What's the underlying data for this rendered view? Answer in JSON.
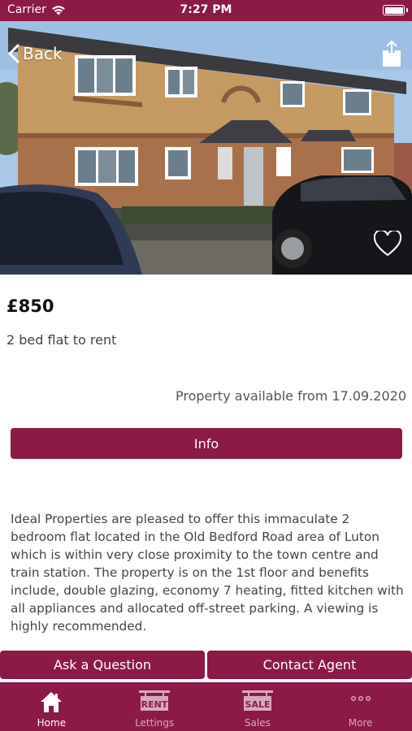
{
  "status_bar": {
    "carrier": "Carrier",
    "time": "7:27 PM"
  },
  "hero": {
    "back_label": "Back"
  },
  "listing": {
    "price": "£850",
    "subtitle": "2 bed flat to rent",
    "availability": "Property available from 17.09.2020",
    "info_label": "Info",
    "description": "Ideal Properties are pleased to offer this immaculate 2 bedroom flat located in the Old Bedford Road area of Luton which is within very close proximity to the town centre and train station. The property is on the 1st floor and benefits include, double glazing, economy 7 heating, fitted kitchen with all appliances and allocated off-street parking. A viewing is highly recommended."
  },
  "actions": {
    "ask": "Ask a Question",
    "contact": "Contact Agent"
  },
  "tabs": [
    {
      "label": "Home",
      "icon": "home-icon",
      "active": true
    },
    {
      "label": "Lettings",
      "icon": "rent-sign-icon",
      "sign": "RENT"
    },
    {
      "label": "Sales",
      "icon": "sale-sign-icon",
      "sign": "SALE"
    },
    {
      "label": "More",
      "icon": "more-icon"
    }
  ],
  "colors": {
    "brand": "#8b1a45"
  }
}
